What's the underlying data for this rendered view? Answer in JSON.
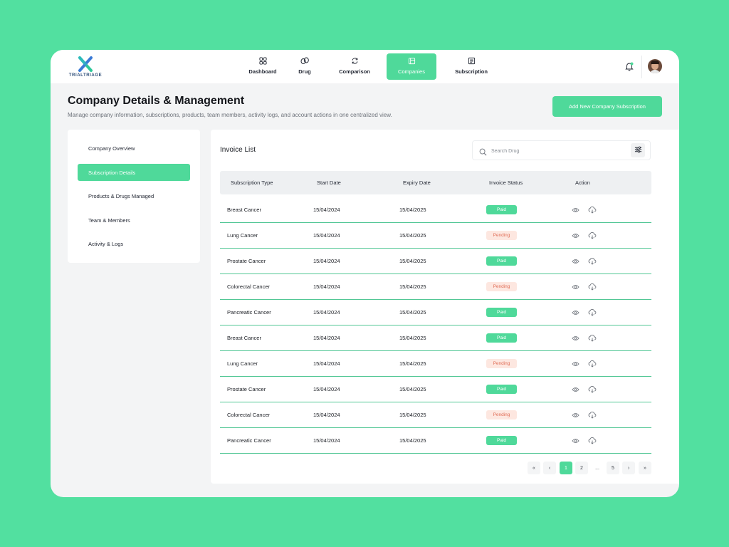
{
  "brand": {
    "name": "TRIALTRIAGE"
  },
  "nav": [
    {
      "label": "Dashboard",
      "icon": "grid-icon",
      "active": false
    },
    {
      "label": "Drug",
      "icon": "pills-icon",
      "active": false
    },
    {
      "label": "Comparison",
      "icon": "refresh-icon",
      "active": false
    },
    {
      "label": "Companies",
      "icon": "building-icon",
      "active": true
    },
    {
      "label": "Subscription",
      "icon": "receipt-icon",
      "active": false
    }
  ],
  "header": {
    "title": "Company Details & Management",
    "subtitle": "Manage company information, subscriptions, products, team members, activity logs, and account actions in one centralized view.",
    "add_button": "Add New Company Subscription"
  },
  "sidebar": {
    "items": [
      {
        "label": "Company Overview",
        "active": false
      },
      {
        "label": "Subscription Details",
        "active": true
      },
      {
        "label": "Products & Drugs Managed",
        "active": false
      },
      {
        "label": "Team & Members",
        "active": false
      },
      {
        "label": "Activity & Logs",
        "active": false
      }
    ]
  },
  "invoices": {
    "title": "Invoice List",
    "search_placeholder": "Search Drug",
    "columns": [
      "Subscription Type",
      "Start Date",
      "Expiry Date",
      "Invoice Status",
      "Action"
    ],
    "rows": [
      {
        "type": "Breast Cancer",
        "start": "15/04/2024",
        "expiry": "15/04/2025",
        "status": "Paid"
      },
      {
        "type": "Lung Cancer",
        "start": "15/04/2024",
        "expiry": "15/04/2025",
        "status": "Pending"
      },
      {
        "type": "Prostate Cancer",
        "start": "15/04/2024",
        "expiry": "15/04/2025",
        "status": "Paid"
      },
      {
        "type": "Colorectal Cancer",
        "start": "15/04/2024",
        "expiry": "15/04/2025",
        "status": "Pending"
      },
      {
        "type": "Pancreatic Cancer",
        "start": "15/04/2024",
        "expiry": "15/04/2025",
        "status": "Paid"
      },
      {
        "type": "Breast Cancer",
        "start": "15/04/2024",
        "expiry": "15/04/2025",
        "status": "Paid"
      },
      {
        "type": "Lung Cancer",
        "start": "15/04/2024",
        "expiry": "15/04/2025",
        "status": "Pending"
      },
      {
        "type": "Prostate Cancer",
        "start": "15/04/2024",
        "expiry": "15/04/2025",
        "status": "Paid"
      },
      {
        "type": "Colorectal Cancer",
        "start": "15/04/2024",
        "expiry": "15/04/2025",
        "status": "Pending"
      },
      {
        "type": "Pancreatic Cancer",
        "start": "15/04/2024",
        "expiry": "15/04/2025",
        "status": "Paid"
      }
    ]
  },
  "pagination": {
    "first": "«",
    "prev": "‹",
    "next": "›",
    "last": "»",
    "pages": [
      "1",
      "2",
      "...",
      "5"
    ],
    "current": "1"
  },
  "colors": {
    "background": "#52e0a0",
    "accent": "#4fd99a",
    "pending_bg": "#fde7e0",
    "pending_text": "#e0705a"
  }
}
